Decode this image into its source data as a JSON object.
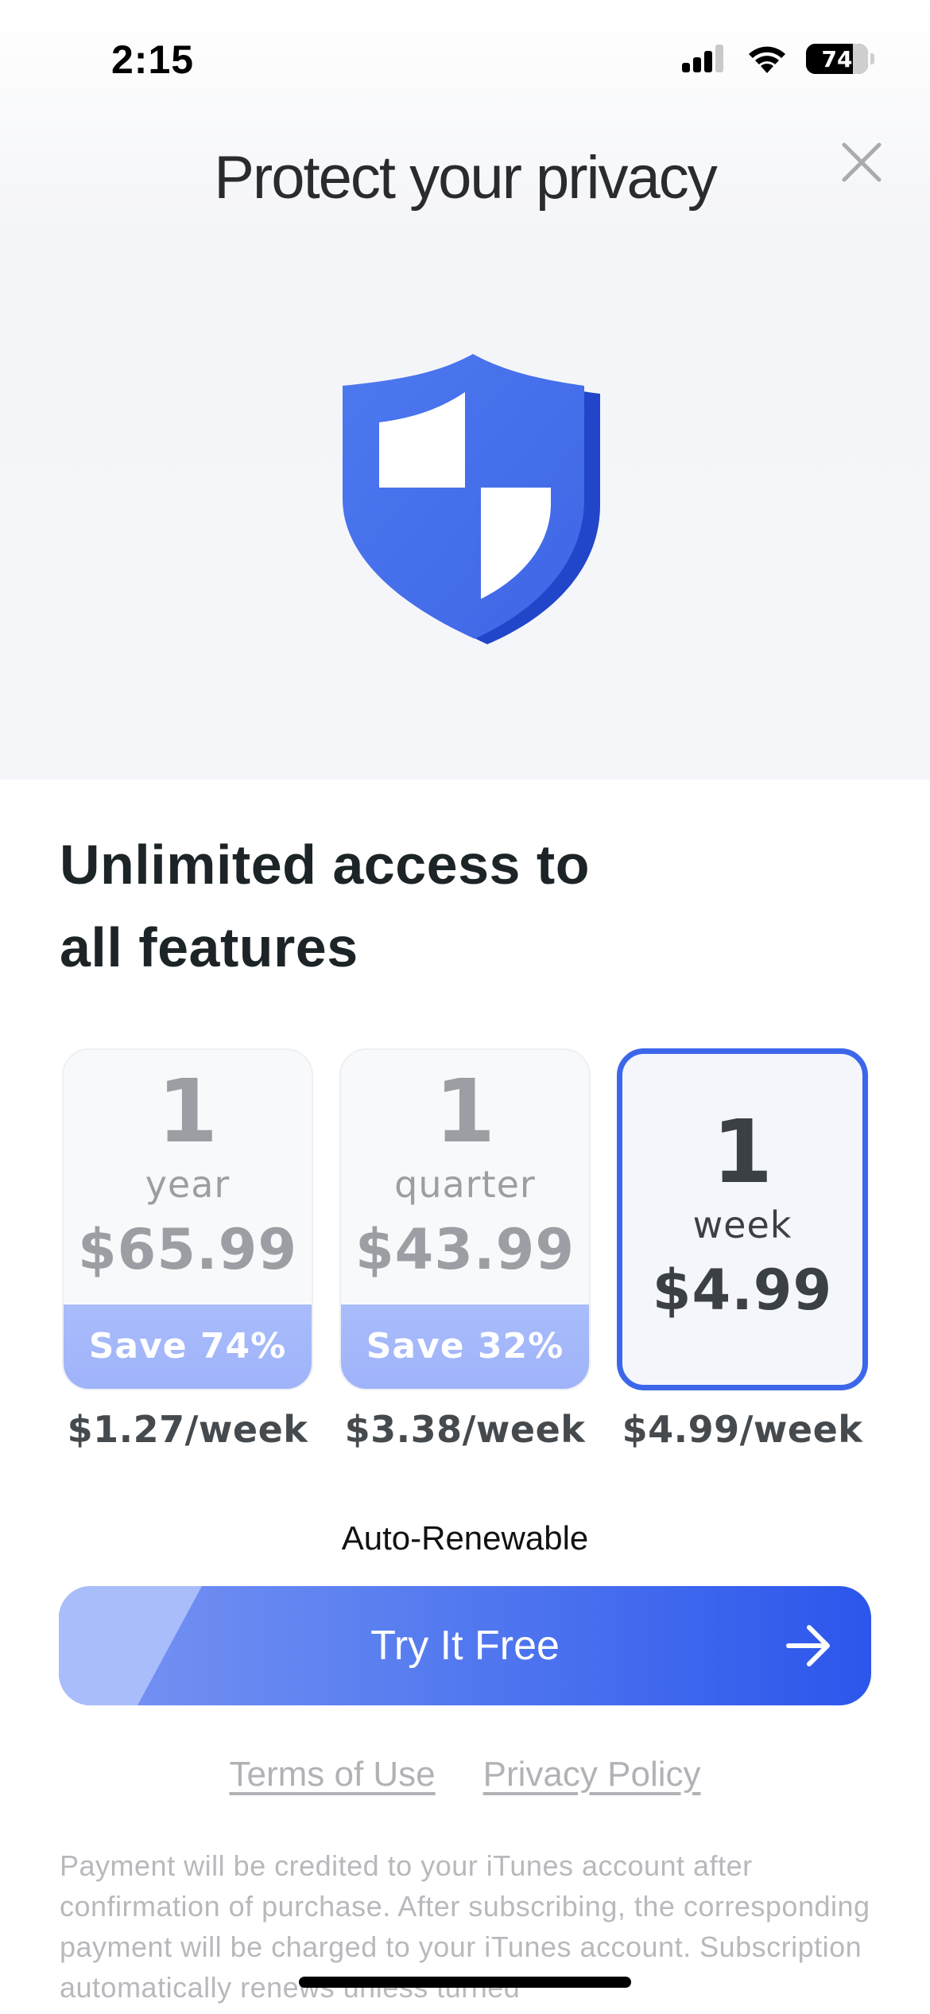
{
  "status_bar": {
    "time": "2:15",
    "battery": "74"
  },
  "header": {
    "title": "Protect your privacy"
  },
  "headline": {
    "line1": "Unlimited access to",
    "line2": "all features"
  },
  "plans": [
    {
      "count": "1",
      "unit": "year",
      "price": "$65.99",
      "save": "Save 74%",
      "weekly": "$1.27/week",
      "selected": false
    },
    {
      "count": "1",
      "unit": "quarter",
      "price": "$43.99",
      "save": "Save 32%",
      "weekly": "$3.38/week",
      "selected": false
    },
    {
      "count": "1",
      "unit": "week",
      "price": "$4.99",
      "save": "",
      "weekly": "$4.99/week",
      "selected": true
    }
  ],
  "auto_renew": "Auto-Renewable",
  "cta": {
    "label": "Try It Free"
  },
  "links": {
    "terms": "Terms of Use",
    "privacy": "Privacy Policy"
  },
  "fineprint": "Payment will be credited to your iTunes account after confirmation of purchase. After subscribing, the corresponding payment will be charged to your iTunes account. Subscription automatically renews unless turned",
  "colors": {
    "accent": "#3d67ea",
    "save_badge": "#a9bcfb",
    "cta_start": "#7a95f3",
    "cta_end": "#2c56ec"
  },
  "icons": {
    "close": "close-icon",
    "arrow": "arrow-right-icon",
    "shield": "shield-icon"
  }
}
